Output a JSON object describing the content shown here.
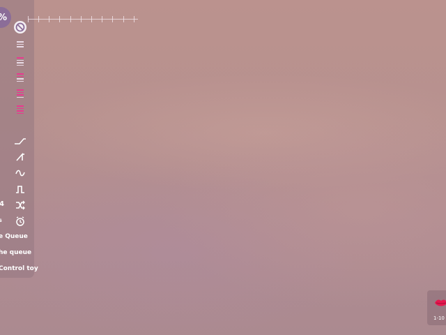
{
  "overlay": {
    "intensity_readout": "%",
    "queue_label": "e Queue",
    "in_queue_label": "he queue",
    "control_label": "Control toy",
    "cycle_value": "4",
    "timer_value": "s"
  },
  "ruler": {
    "tick_count": 11
  },
  "levels": [
    {
      "name": "level-1",
      "color": "#e9dbe6"
    },
    {
      "name": "level-2",
      "color": "#e83a8f"
    },
    {
      "name": "level-3",
      "color": "#e83a8f"
    },
    {
      "name": "level-4",
      "color": "#e83a8f"
    },
    {
      "name": "level-5",
      "color": "#e83a8f"
    }
  ],
  "pattern_icons": [
    "ramp-up-icon",
    "step-ramp-icon",
    "wave-icon",
    "pulse-icon",
    "shuffle-icon",
    "alarm-clock-icon"
  ],
  "tip_badge": {
    "caption": "1-10 t"
  },
  "colors": {
    "accent": "#e83a8f",
    "chip": "#8b6d98"
  }
}
